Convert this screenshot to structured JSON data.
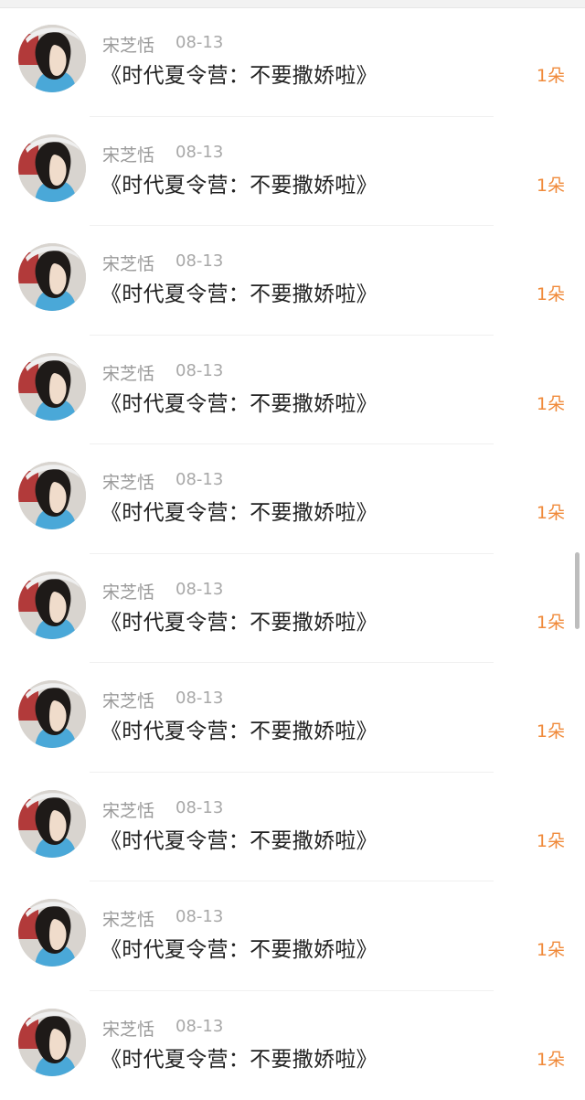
{
  "colors": {
    "name_text": "#9a9a9a",
    "date_text": "#a8a8a8",
    "content_text": "#222222",
    "count_accent": "#f08a3a",
    "scrollbar": "#bdbdbd"
  },
  "list": {
    "items": [
      {
        "name": "宋芝恬",
        "date": "08-13",
        "content": "《时代夏令营：不要撒娇啦》",
        "count": "1朵",
        "avatar_icon": "user-avatar-icon"
      },
      {
        "name": "宋芝恬",
        "date": "08-13",
        "content": "《时代夏令营：不要撒娇啦》",
        "count": "1朵",
        "avatar_icon": "user-avatar-icon"
      },
      {
        "name": "宋芝恬",
        "date": "08-13",
        "content": "《时代夏令营：不要撒娇啦》",
        "count": "1朵",
        "avatar_icon": "user-avatar-icon"
      },
      {
        "name": "宋芝恬",
        "date": "08-13",
        "content": "《时代夏令营：不要撒娇啦》",
        "count": "1朵",
        "avatar_icon": "user-avatar-icon"
      },
      {
        "name": "宋芝恬",
        "date": "08-13",
        "content": "《时代夏令营：不要撒娇啦》",
        "count": "1朵",
        "avatar_icon": "user-avatar-icon"
      },
      {
        "name": "宋芝恬",
        "date": "08-13",
        "content": "《时代夏令营：不要撒娇啦》",
        "count": "1朵",
        "avatar_icon": "user-avatar-icon"
      },
      {
        "name": "宋芝恬",
        "date": "08-13",
        "content": "《时代夏令营：不要撒娇啦》",
        "count": "1朵",
        "avatar_icon": "user-avatar-icon"
      },
      {
        "name": "宋芝恬",
        "date": "08-13",
        "content": "《时代夏令营：不要撒娇啦》",
        "count": "1朵",
        "avatar_icon": "user-avatar-icon"
      },
      {
        "name": "宋芝恬",
        "date": "08-13",
        "content": "《时代夏令营：不要撒娇啦》",
        "count": "1朵",
        "avatar_icon": "user-avatar-icon"
      },
      {
        "name": "宋芝恬",
        "date": "08-13",
        "content": "《时代夏令营：不要撒娇啦》",
        "count": "1朵",
        "avatar_icon": "user-avatar-icon"
      }
    ]
  }
}
